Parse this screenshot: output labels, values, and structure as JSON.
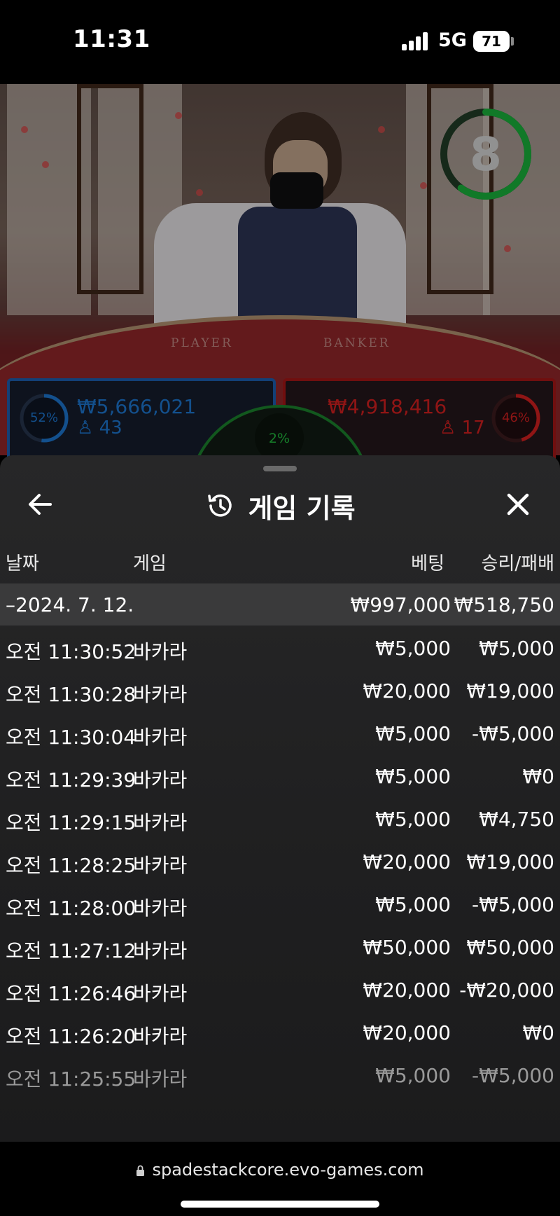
{
  "status_bar": {
    "time": "11:31",
    "network": "5G",
    "battery": "71"
  },
  "live_table": {
    "timer": "8",
    "timer_progress": 0.6,
    "player_label": "PLAYER",
    "banker_label": "BANKER",
    "player": {
      "percent": "52%",
      "amount": "₩5,666,021",
      "count": "43",
      "color": "#1b6fc4"
    },
    "banker": {
      "percent": "46%",
      "amount": "₩4,918,416",
      "count": "17",
      "color": "#c81e1e"
    },
    "tie": {
      "percent": "2%",
      "color": "#1fae3a"
    }
  },
  "sheet": {
    "title": "게임 기록",
    "columns": {
      "date": "날짜",
      "game": "게임",
      "bet": "베팅",
      "result": "승리/패배"
    },
    "summary": {
      "date": "–2024. 7. 12.",
      "bet": "₩997,000",
      "result": "₩518,750"
    },
    "rows": [
      {
        "time": "오전 11:30:52",
        "game": "바카라",
        "bet": "₩5,000",
        "result": "₩5,000"
      },
      {
        "time": "오전 11:30:28",
        "game": "바카라",
        "bet": "₩20,000",
        "result": "₩19,000"
      },
      {
        "time": "오전 11:30:04",
        "game": "바카라",
        "bet": "₩5,000",
        "result": "-₩5,000"
      },
      {
        "time": "오전 11:29:39",
        "game": "바카라",
        "bet": "₩5,000",
        "result": "₩0"
      },
      {
        "time": "오전 11:29:15",
        "game": "바카라",
        "bet": "₩5,000",
        "result": "₩4,750"
      },
      {
        "time": "오전 11:28:25",
        "game": "바카라",
        "bet": "₩20,000",
        "result": "₩19,000"
      },
      {
        "time": "오전 11:28:00",
        "game": "바카라",
        "bet": "₩5,000",
        "result": "-₩5,000"
      },
      {
        "time": "오전 11:27:12",
        "game": "바카라",
        "bet": "₩50,000",
        "result": "₩50,000"
      },
      {
        "time": "오전 11:26:46",
        "game": "바카라",
        "bet": "₩20,000",
        "result": "-₩20,000"
      },
      {
        "time": "오전 11:26:20",
        "game": "바카라",
        "bet": "₩20,000",
        "result": "₩0"
      },
      {
        "time": "오전 11:25:55",
        "game": "바카라",
        "bet": "₩5,000",
        "result": "-₩5,000"
      }
    ]
  },
  "browser": {
    "url": "spadestackcore.evo-games.com"
  },
  "icons": {
    "back": "arrow-left-icon",
    "history": "history-icon",
    "close": "close-icon",
    "lock": "lock-icon"
  }
}
